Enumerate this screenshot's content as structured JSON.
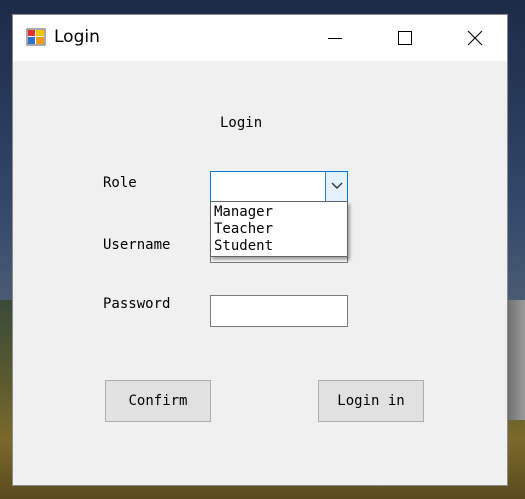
{
  "window": {
    "title": "Login",
    "icon": "windows-forms-app-icon"
  },
  "form": {
    "heading": "Login",
    "role_label": "Role",
    "role_value": "",
    "role_options": [
      "Manager",
      "Teacher",
      "Student"
    ],
    "username_label": "Username",
    "password_label": "Password",
    "password_value": "",
    "confirm_label": "Confirm",
    "login_label": "Login in"
  },
  "colors": {
    "focus_border": "#0078d7",
    "window_bg": "#f0f0f0",
    "button_bg": "#e1e1e1"
  }
}
